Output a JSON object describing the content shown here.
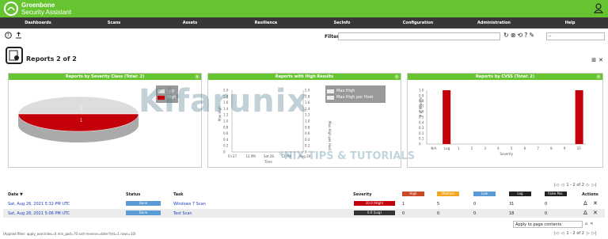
{
  "brand": {
    "line1": "Greenbone",
    "line2": "Security Assistant"
  },
  "nav": [
    "Dashboards",
    "Scans",
    "Assets",
    "Resilience",
    "SecInfo",
    "Configuration",
    "Administration",
    "Help"
  ],
  "filter": {
    "label": "Filter",
    "value": "",
    "select": "--"
  },
  "page": {
    "title": "Reports 2 of 2"
  },
  "panels": [
    {
      "title": "Reports by Severity Class (Total: 2)",
      "legend": [
        "Log",
        "High"
      ]
    },
    {
      "title": "Reports with High Results",
      "legend": [
        "Max High",
        "Max High per Host"
      ]
    },
    {
      "title": "Reports by CVSS (Total: 2)"
    }
  ],
  "chart_data": [
    {
      "type": "pie",
      "title": "Reports by Severity Class (Total: 2)",
      "slices": [
        {
          "label": "Log",
          "value": 1,
          "color": "#dddddd"
        },
        {
          "label": "High",
          "value": 1,
          "color": "#c4000a"
        }
      ],
      "slice_labels": [
        "1",
        "1"
      ]
    },
    {
      "type": "line",
      "title": "Reports with High Results",
      "ylabel": "Max High",
      "y2label": "Max High per Host",
      "xlabel": "Time",
      "x_ticks": [
        "Fri 27",
        "12 PM",
        "Sat 28",
        "12 PM",
        "Aug 29"
      ],
      "y_ticks": [
        "0",
        "0.2",
        "0.4",
        "0.6",
        "0.8",
        "1.0",
        "1.2",
        "1.4",
        "1.6",
        "1.8",
        "2.0"
      ],
      "y2_ticks": [
        "0",
        "0.2",
        "0.4",
        "0.6",
        "0.8",
        "1.0",
        "1.2",
        "1.4",
        "1.6",
        "1.8",
        "2.0"
      ],
      "series": [
        {
          "name": "Max High",
          "values": []
        },
        {
          "name": "Max High per Host",
          "values": []
        }
      ]
    },
    {
      "type": "bar",
      "title": "Reports by CVSS (Total: 2)",
      "xlabel": "Severity",
      "ylabel": "# of Reports",
      "categories": [
        "N/A",
        "Log",
        "1",
        "2",
        "3",
        "4",
        "5",
        "6",
        "7",
        "8",
        "9",
        "10"
      ],
      "values": [
        0,
        1,
        0,
        0,
        0,
        0,
        0,
        0,
        0,
        0,
        0,
        1
      ],
      "y_ticks": [
        "0",
        "0.1",
        "0.2",
        "0.3",
        "0.4",
        "0.5",
        "0.6",
        "0.7",
        "0.8",
        "0.9",
        "1.0"
      ],
      "ylim": [
        0,
        1
      ],
      "bar_color": "#c4000a"
    }
  ],
  "pager_top": "1 - 2 of 2",
  "pager_bottom": "1 - 2 of 2",
  "table": {
    "headers": {
      "date": "Date ▼",
      "status": "Status",
      "task": "Task",
      "severity": "Severity",
      "actions": "Actions"
    },
    "sev_labels": [
      {
        "label": "High",
        "color": "#c94a26"
      },
      {
        "label": "Medium",
        "color": "#f5a623"
      },
      {
        "label": "Low",
        "color": "#5b9bd5"
      },
      {
        "label": "Log",
        "color": "#222222"
      },
      {
        "label": "False Pos.",
        "color": "#222222"
      }
    ],
    "rows": [
      {
        "date": "Sat, Aug 28, 2021 5:32 PM UTC",
        "status": "Done",
        "task": "Windows 7 Scan",
        "severity": "10.0 (High)",
        "sev_color": "#c4000a",
        "high": "1",
        "medium": "5",
        "low": "0",
        "log": "31",
        "fp": "0"
      },
      {
        "date": "Sat, Aug 28, 2021 5:06 PM UTC",
        "status": "Done",
        "task": "Test Scan",
        "severity": "0.0 (Log)",
        "sev_color": "#333333",
        "high": "0",
        "medium": "0",
        "low": "0",
        "log": "18",
        "fp": "0"
      }
    ]
  },
  "page_select": "Apply to page contents",
  "applied_filter": "(Applied filter: apply_overrides=0 min_qod=70 sort-reverse=date first=1 rows=10)",
  "watermark": {
    "main": "Kifarunix",
    "sub": "*NIX TIPS & TUTORIALS"
  }
}
